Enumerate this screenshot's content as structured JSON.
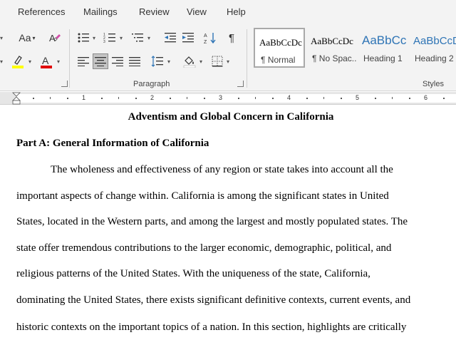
{
  "menu": {
    "tabs": [
      "References",
      "Mailings",
      "Review",
      "View",
      "Help"
    ]
  },
  "ribbon": {
    "font_size_button": "Aa",
    "paragraph_mark": "¶",
    "paragraph_group_label": "Paragraph",
    "styles_group_label": "Styles",
    "styles": [
      {
        "preview": "AaBbCcDc",
        "name": "¶ Normal",
        "selected": true
      },
      {
        "preview": "AaBbCcDc",
        "name": "¶ No Spac...",
        "selected": false
      },
      {
        "preview": "AaBbCc",
        "name": "Heading 1",
        "selected": false
      },
      {
        "preview": "AaBbCcD",
        "name": "Heading 2",
        "selected": false
      }
    ],
    "highlight_color": "#ffff00",
    "font_color": "#e00000"
  },
  "ruler": {
    "numbers": [
      "1",
      "2",
      "3",
      "4",
      "5",
      "6"
    ]
  },
  "document": {
    "title": "Adventism and Global Concern in California",
    "heading": "Part A: General Information of California",
    "lines": [
      "The wholeness and effectiveness of any region or state takes into account all the",
      "important aspects of change within. California is among the significant states in United",
      "States, located in the Western parts, and among the largest and mostly populated states. The",
      "state offer tremendous contributions to the larger economic, demographic, political, and",
      "religious patterns of the United States. With the uniqueness of the state, California,",
      "dominating the United States, there exists significant definitive contexts, current events, and",
      "historic contexts on the important topics of a nation. In this section, highlights are critically"
    ]
  }
}
